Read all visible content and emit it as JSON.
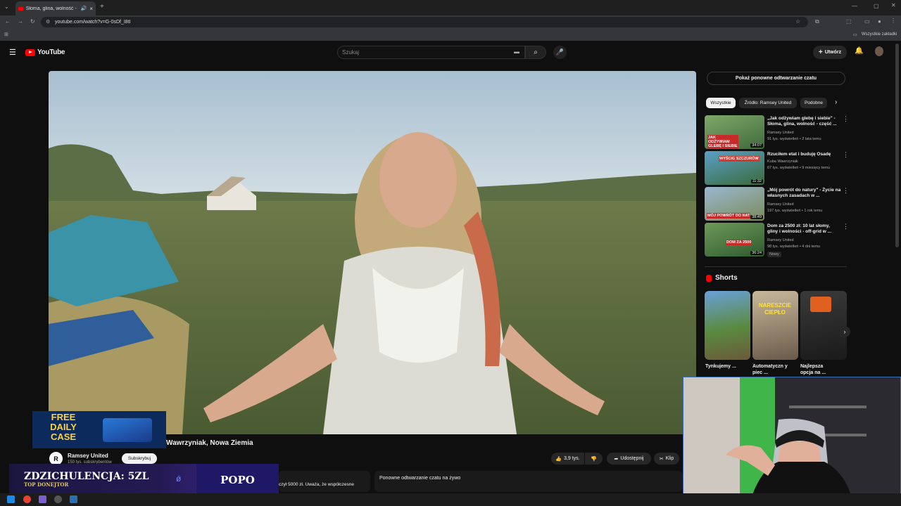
{
  "browser": {
    "tab_title": "Słoma, glina, wolność - cz...",
    "url": "youtube.com/watch?v=G-0sDf_I8tI",
    "bookmarks_label": "Wszystkie zakładki"
  },
  "masthead": {
    "logo_text": "YouTube",
    "search_placeholder": "Szukaj",
    "create_label": "Utwórz"
  },
  "video": {
    "title": "Wawrzyniak, Nowa Ziemia",
    "channel_name": "Ramsey United",
    "channel_initial": "R",
    "channel_subs": "150 tys. subskrybentów",
    "subscribe_label": "Subskrybuj",
    "likes": "3,9 tys.",
    "share_label": "Udostępnij",
    "clip_label": "Klip",
    "chat_replay_label": "Ponowne odtwarzanie czatu na żywo",
    "description_snippet": "czył 5000 zł. Uważa, że współczesne"
  },
  "sidebar": {
    "show_chat_replay": "Pokaż ponowne odtwarzanie czatu",
    "chips": [
      "Wszystkie",
      "Źródło: Ramsey United",
      "Podobne"
    ],
    "recommendations": [
      {
        "title": "„Jak odżywiam glebę i siebie\" - Słoma, glina, wolność - część ...",
        "channel": "Ramsey United",
        "meta": "91 tys. wyświetleń • 2 lata temu",
        "duration": "34:07",
        "thumb_text": "JAK ODŻYWIAM GLEBĘ I SIEBIE"
      },
      {
        "title": "Rzuciłem etat i buduję Osadę",
        "channel": "Kuba Wawrzyniak",
        "meta": "67 tys. wyświetleń • 9 miesięcy temu",
        "duration": "11:32",
        "thumb_text": "WYŚCIG SZCZURÓW"
      },
      {
        "title": "„Mój powrót do natury\" - Życie na własnych zasadach w ...",
        "channel": "Ramsey United",
        "meta": "197 tys. wyświetleń • 1 rok temu",
        "duration": "38:49",
        "thumb_text": "MÓJ POWRÓT DO NAT"
      },
      {
        "title": "Dom za 2500 zł: 10 lat słomy, gliny i wolności - off-grid w ...",
        "channel": "Ramsey United",
        "meta": "98 tys. wyświetleń • 4 dni temu",
        "duration": "36:24",
        "thumb_text": "DOM ZA 2500",
        "badge": "Nowy"
      }
    ],
    "shorts_heading": "Shorts",
    "shorts": [
      {
        "title": "Tynkujemy ...",
        "thumb_text": ""
      },
      {
        "title": "Automatyczn y piec ...",
        "thumb_text": "NARESZCIE CIEPŁO"
      },
      {
        "title": "Najlepsza opcja na ...",
        "thumb_text": ""
      }
    ]
  },
  "overlays": {
    "free_case_line1": "FREE",
    "free_case_line2": "DAILY",
    "free_case_line3": "CASE",
    "donate_main": "ZDZICHULENCJA: 5ZL",
    "donate_sub": "TOP DONEJTOR",
    "donate_right": "POPO"
  },
  "colors": {
    "brand_red": "#ff0000",
    "background": "#0f0f0f",
    "donate_purple": "#1e1866"
  }
}
